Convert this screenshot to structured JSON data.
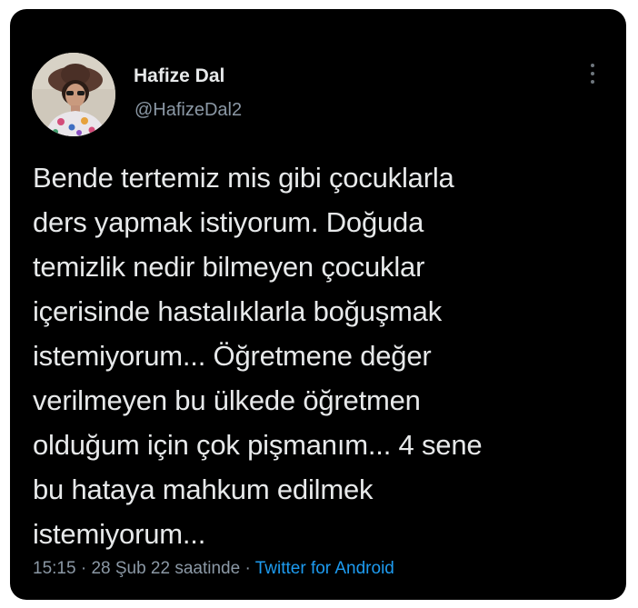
{
  "tweet": {
    "author": {
      "name": "Hafize Dal",
      "handle": "@HafizeDal2",
      "avatar_icon": "profile-photo"
    },
    "more_icon": "more-vertical-icon",
    "text_lines": [
      "Bende tertemiz mis gibi çocuklarla",
      "ders yapmak istiyorum. Doğuda",
      "temizlik nedir bilmeyen çocuklar",
      "içerisinde hastalıklarla boğuşmak",
      "istemiyorum... Öğretmene değer",
      "verilmeyen bu ülkede öğretmen",
      "olduğum için çok pişmanım... 4 sene",
      "bu hataya mahkum edilmek",
      "istemiyorum..."
    ],
    "time": "15:15",
    "separator": " · ",
    "date": "28 Şub 22 saatinde",
    "source": "Twitter for Android"
  },
  "colors": {
    "card_background": "#000000",
    "text": "#e7e9ea",
    "secondary_text": "#8b98a5",
    "link": "#1d9bf0"
  }
}
